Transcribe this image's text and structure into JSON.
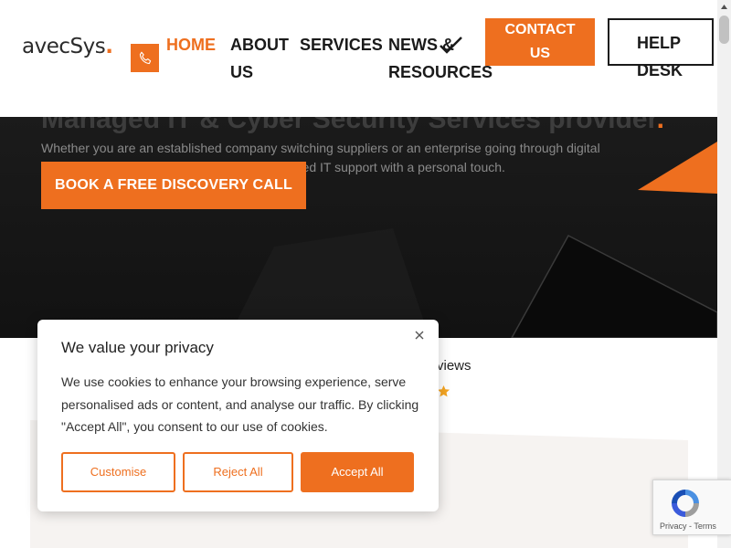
{
  "header": {
    "logo_text": "avecSys",
    "logo_dot": ".",
    "nav": {
      "home": "HOME",
      "about": "ABOUT US",
      "services": "SERVICES",
      "news": "NEWS & RESOURCES"
    },
    "contact_label": "CONTACT US",
    "helpdesk_label": "HELP DESK"
  },
  "hero": {
    "title": "Managed IT & Cyber Security Services provider",
    "title_dot": ".",
    "subtitle": "Whether you are an established company switching suppliers or an enterprise going through digital transformation, we can help you with our tailored IT support with a personal touch.",
    "cta_label": "BOOK A FREE DISCOVERY CALL"
  },
  "reviews": {
    "label": "views"
  },
  "cookie_banner": {
    "title": "We value your privacy",
    "body": "We use cookies to enhance your browsing experience, serve personalised ads or content, and analyse our traffic. By clicking \"Accept All\", you consent to our use of cookies.",
    "customise_label": "Customise",
    "reject_label": "Reject All",
    "accept_label": "Accept All"
  },
  "recaptcha": {
    "links": "Privacy - Terms"
  },
  "colors": {
    "accent": "#ee6f1f",
    "dark": "#161616",
    "text": "#1a1a1a"
  }
}
